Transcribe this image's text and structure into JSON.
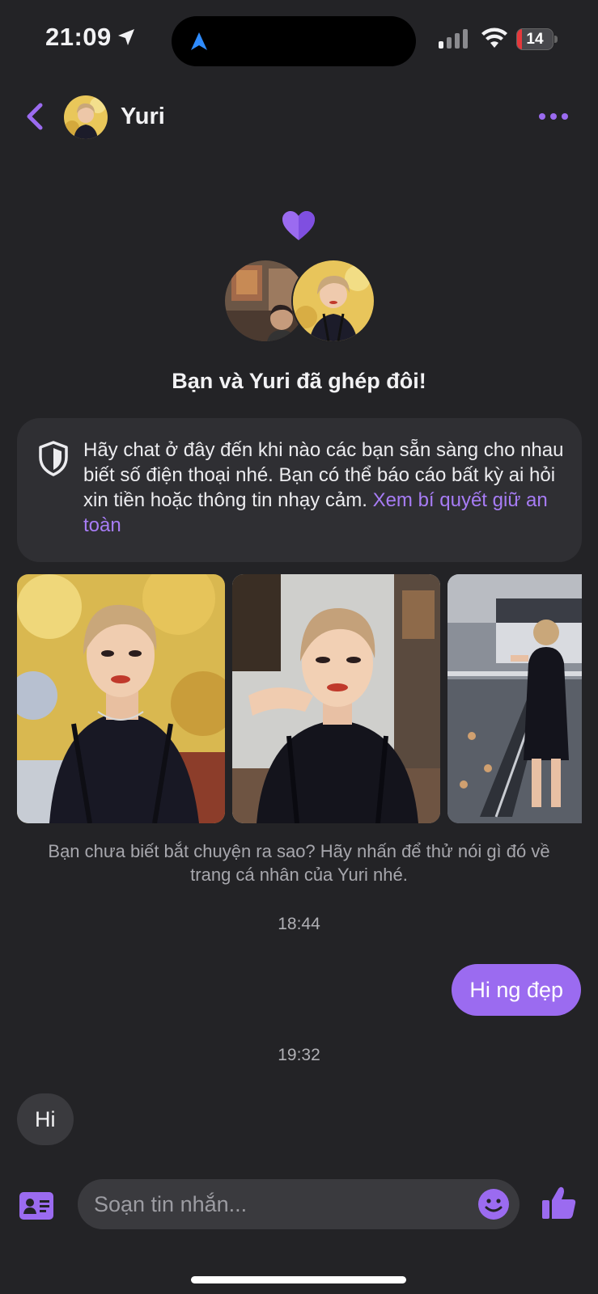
{
  "status_bar": {
    "time": "21:09",
    "battery": "14",
    "battery_level": 0.14,
    "signal_bars_on": 1
  },
  "header": {
    "contact_name": "Yuri",
    "back_icon": "chevron-left-icon",
    "more_icon": "more-horizontal-icon"
  },
  "match": {
    "title": "Bạn và Yuri đã ghép đôi!",
    "heart_icon": "heart-icon"
  },
  "safety": {
    "text": "Hãy chat ở đây đến khi nào các bạn sẵn sàng cho nhau biết số điện thoại nhé. Bạn có thể báo cáo bất kỳ ai hỏi xin tiền hoặc thông tin nhạy cảm. ",
    "link": "Xem bí quyết giữ an toàn",
    "icon": "shield-icon"
  },
  "photos": {
    "count": 3
  },
  "hint": "Bạn chưa biết bắt chuyện ra sao? Hãy nhấn để thử nói gì đó về trang cá nhân của Yuri nhé.",
  "messages": [
    {
      "type": "timestamp",
      "text": "18:44"
    },
    {
      "type": "outgoing",
      "text": "Hi ng đẹp"
    },
    {
      "type": "timestamp",
      "text": "19:32"
    },
    {
      "type": "incoming",
      "text": "Hi"
    }
  ],
  "composer": {
    "placeholder": "Soạn tin nhắn...",
    "left_icon": "contact-card-icon",
    "emoji_icon": "smiley-icon",
    "send_icon": "thumbs-up-icon"
  },
  "colors": {
    "background": "#232326",
    "accent": "#9b6bf0",
    "link": "#a77cf5",
    "card": "#2f2f33",
    "bubble_incoming": "#3a3a3e"
  }
}
